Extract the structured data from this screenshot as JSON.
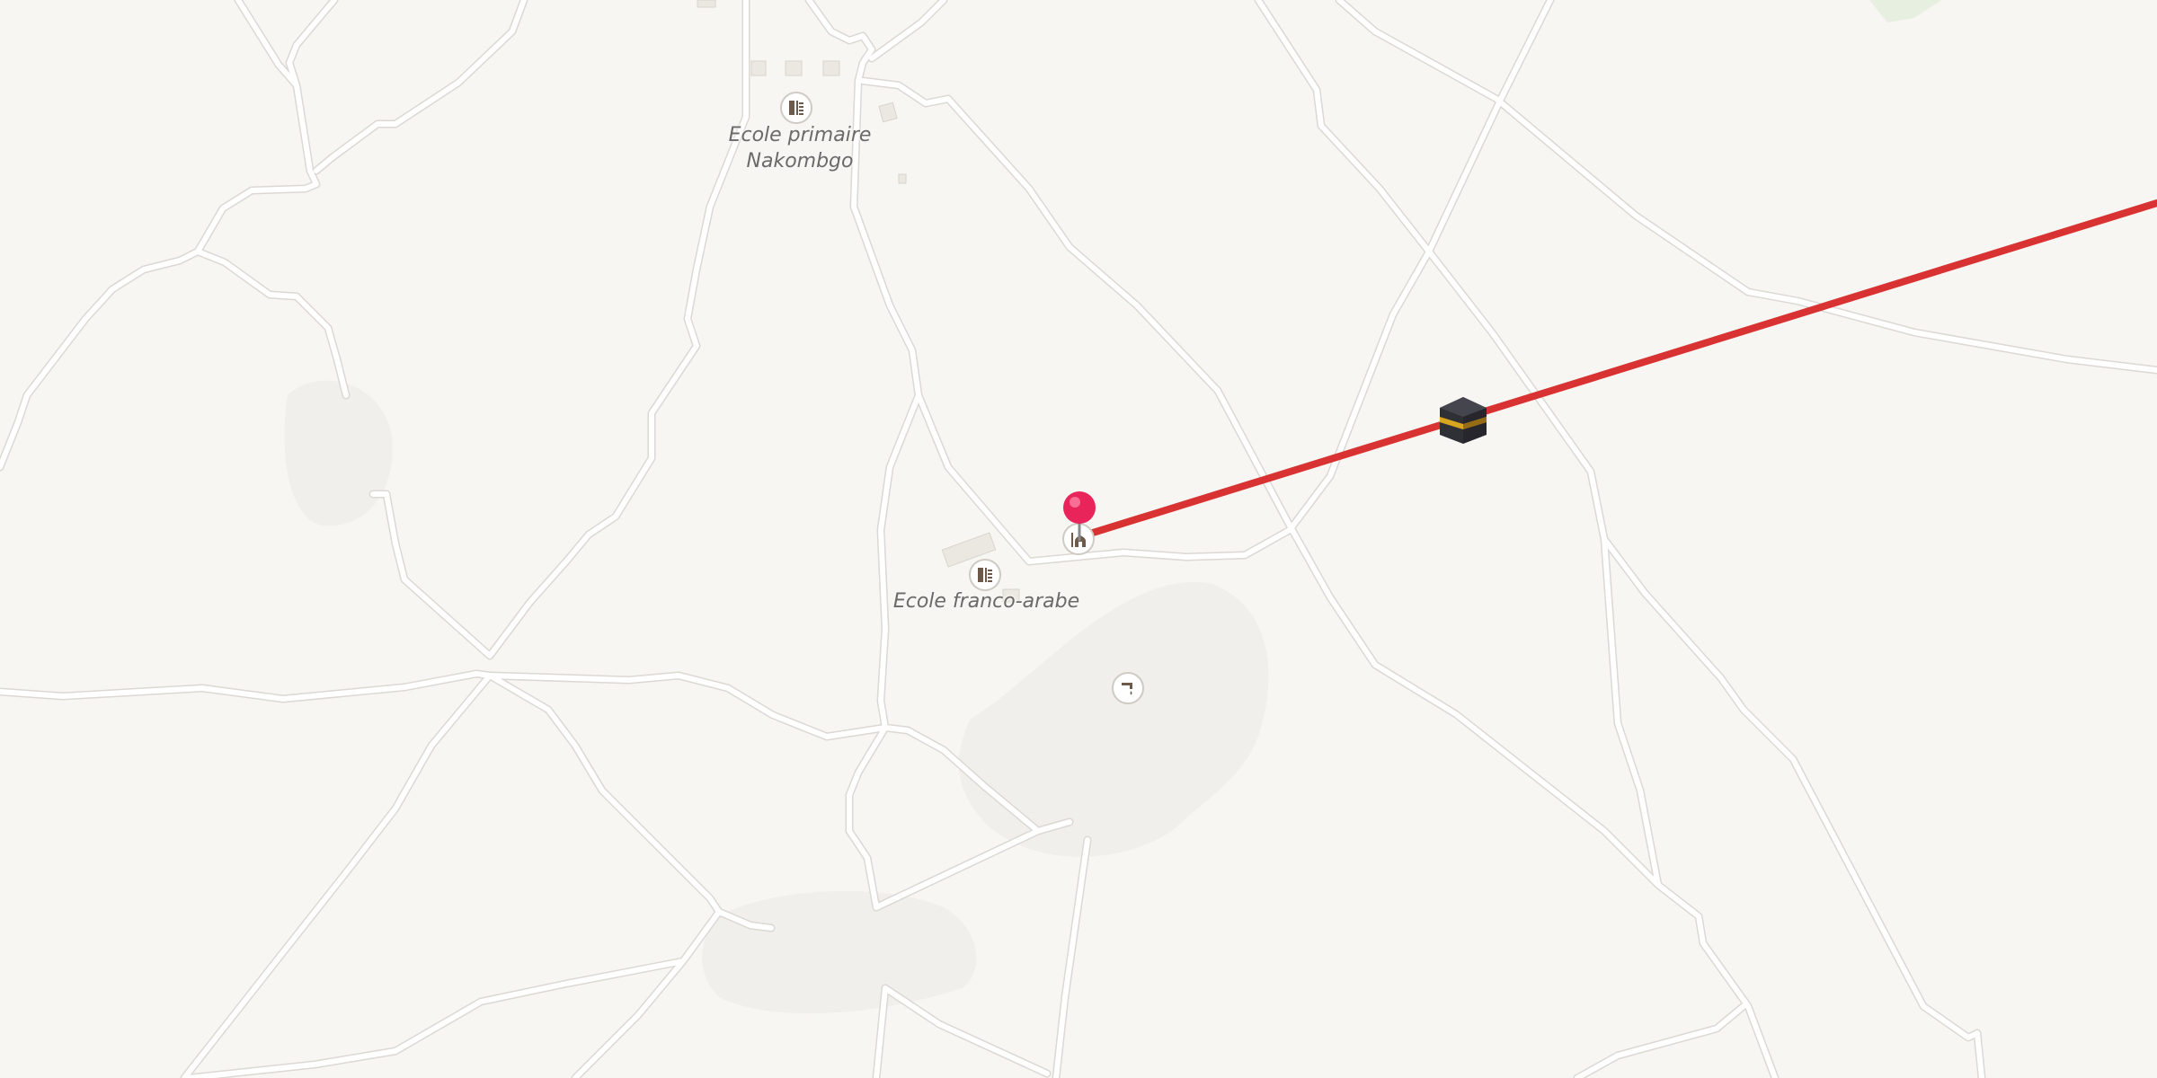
{
  "map": {
    "background": "#f8f6f2",
    "road_color": "#ffffff",
    "road_casing_color": "#dcd8d3",
    "route_color": "#d83232",
    "pin_color": "#e8245a"
  },
  "labels": {
    "school_north": "Ecole primaire\nNakombgo",
    "school_center": "Ecole franco-arabe"
  },
  "icons": {
    "school_north": "school-icon",
    "school_center": "school-icon",
    "mosque": "mosque-icon",
    "water": "water-tap-icon",
    "pin": "location-pin-icon",
    "qibla_target": "kaaba-icon"
  }
}
